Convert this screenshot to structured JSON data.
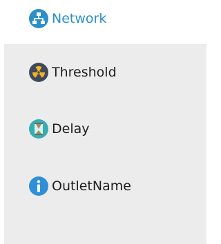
{
  "header": {
    "network": {
      "label": "Network",
      "icon": "network-icon",
      "color": "#2b8fc8"
    }
  },
  "menu": {
    "items": [
      {
        "label": "Threshold",
        "icon": "radiation-icon"
      },
      {
        "label": "Delay",
        "icon": "hourglass-icon"
      },
      {
        "label": "OutletName",
        "icon": "info-icon"
      }
    ]
  },
  "colors": {
    "panel_background": "#ececec",
    "network_blue": "#2b8fc8",
    "info_blue": "#2f8fd8",
    "radiation_dark": "#3f4a5c",
    "radiation_yellow": "#f3b51b",
    "hourglass_teal": "#35aeb0"
  }
}
